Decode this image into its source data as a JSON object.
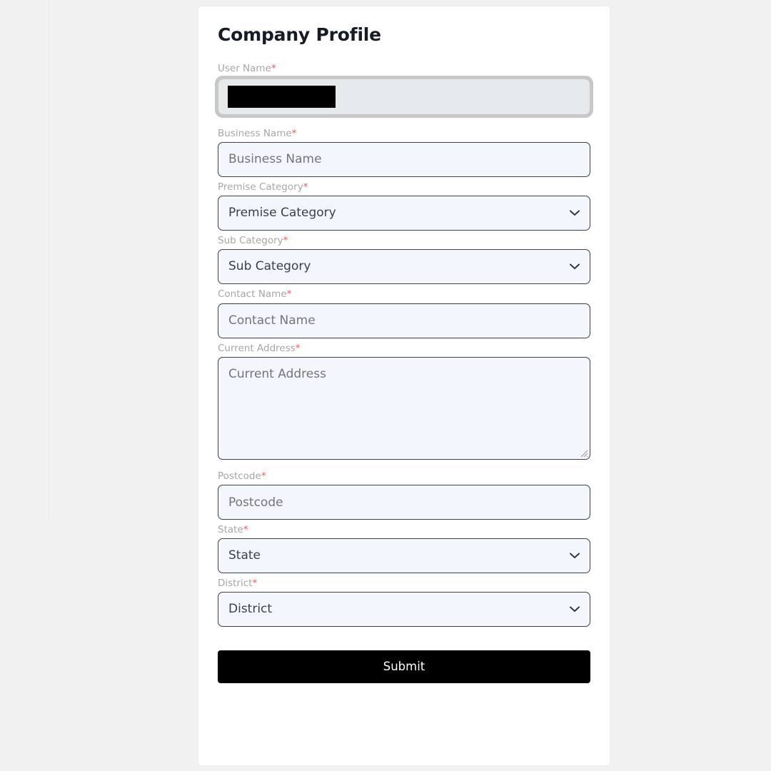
{
  "card": {
    "title": "Company Profile"
  },
  "form": {
    "required_marker": "*",
    "fields": [
      {
        "key": "user_name",
        "label": "User Name",
        "required": true,
        "type": "text",
        "state": "disabled-focused",
        "value_redacted": true,
        "placeholder": ""
      },
      {
        "key": "business_name",
        "label": "Business Name",
        "required": true,
        "type": "text",
        "placeholder": "Business Name",
        "value": ""
      },
      {
        "key": "premise_category",
        "label": "Premise Category",
        "required": true,
        "type": "select",
        "selected": "Premise Category",
        "icon": "chevron-down-icon"
      },
      {
        "key": "sub_category",
        "label": "Sub Category",
        "required": true,
        "type": "select",
        "selected": "Sub Category",
        "icon": "chevron-down-icon"
      },
      {
        "key": "contact_name",
        "label": "Contact Name",
        "required": true,
        "type": "text",
        "placeholder": "Contact Name",
        "value": ""
      },
      {
        "key": "current_address",
        "label": "Current Address",
        "required": true,
        "type": "textarea",
        "placeholder": "Current Address",
        "value": "",
        "icon": "resize-grip-icon"
      },
      {
        "key": "postcode",
        "label": "Postcode",
        "required": true,
        "type": "text",
        "placeholder": "Postcode",
        "value": ""
      },
      {
        "key": "state",
        "label": "State",
        "required": true,
        "type": "select",
        "selected": "State",
        "icon": "chevron-down-icon"
      },
      {
        "key": "district",
        "label": "District",
        "required": true,
        "type": "select",
        "selected": "District",
        "icon": "chevron-down-icon"
      }
    ],
    "submit_label": "Submit"
  },
  "colors": {
    "page_background": "#f1f1f1",
    "card_background": "#ffffff",
    "input_background": "#f4f6fd",
    "input_border": "#3b3f46",
    "disabled_input_background": "#e6eaec",
    "focus_ring": "#c8c8c8",
    "label_text": "#a6a6a6",
    "required_star": "#f8525c",
    "placeholder_text": "#6e747c",
    "select_text": "#3a3f4a",
    "title_text": "#161b26",
    "submit_background": "#000000",
    "submit_text": "#ffffff",
    "redaction": "#000000"
  }
}
